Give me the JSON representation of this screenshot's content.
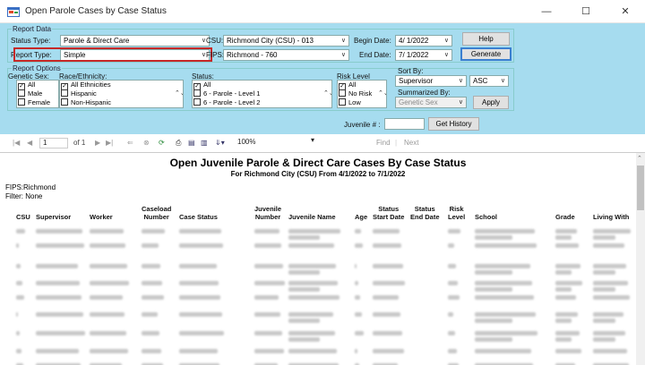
{
  "window": {
    "title": "Open Parole Cases by Case Status",
    "minimize": "—",
    "maximize": "☐",
    "close": "✕"
  },
  "report_data": {
    "legend": "Report Data",
    "status_type_label": "Status Type:",
    "status_type_value": "Parole & Direct Care",
    "report_type_label": "Report Type:",
    "report_type_value": "Simple",
    "csu_label": "CSU:",
    "csu_value": "Richmond City (CSU) - 013",
    "fips_label": "FIPS:",
    "fips_value": "Richmond - 760",
    "begin_label": "Begin Date:",
    "begin_value": "4/ 1/2022",
    "end_label": "End Date:",
    "end_value": "7/ 1/2022",
    "help_button": "Help",
    "generate_button": "Generate"
  },
  "report_options": {
    "legend": "Report Options",
    "genetic_sex_label": "Genetic Sex:",
    "genetic_sex_items": [
      {
        "label": "All",
        "checked": true
      },
      {
        "label": "Male",
        "checked": false
      },
      {
        "label": "Female",
        "checked": false
      }
    ],
    "race_label": "Race/Ethnicity:",
    "race_items": [
      {
        "label": "All Ethnicities",
        "checked": true
      },
      {
        "label": "Hispanic",
        "checked": false
      },
      {
        "label": "Non-Hispanic",
        "checked": false
      }
    ],
    "status_label": "Status:",
    "status_items": [
      {
        "label": "All",
        "checked": true
      },
      {
        "label": "6 - Parole - Level 1",
        "checked": false
      },
      {
        "label": "6 - Parole - Level 2",
        "checked": false
      }
    ],
    "risk_label": "Risk Level",
    "risk_items": [
      {
        "label": "All",
        "checked": true
      },
      {
        "label": "No Risk",
        "checked": false
      },
      {
        "label": "Low",
        "checked": false
      }
    ],
    "sort_label": "Sort By:",
    "sort_value": "Supervisor",
    "sort_dir": "ASC",
    "summarized_label": "Summarized By:",
    "summarized_value": "Genetic Sex",
    "apply_button": "Apply",
    "juvenile_label": "Juvenile # :",
    "juvenile_value": "",
    "history_button": "Get History"
  },
  "toolbar": {
    "first": "|◀",
    "prev": "◀",
    "page": "1",
    "of_pages": "of 1",
    "next": "▶",
    "last": "▶|",
    "zoom": "100%",
    "find": "Find",
    "next_link": "Next"
  },
  "report": {
    "title": "Open Juvenile Parole & Direct Care Cases By Case Status",
    "subtitle": "For Richmond City (CSU) From 4/1/2022 to 7/1/2022",
    "fips": "FIPS:Richmond",
    "filter": "Filter: None",
    "columns": [
      {
        "l1": "",
        "l2": "CSU"
      },
      {
        "l1": "",
        "l2": "Supervisor"
      },
      {
        "l1": "",
        "l2": "Worker"
      },
      {
        "l1": "Caseload",
        "l2": "Number"
      },
      {
        "l1": "",
        "l2": "Case Status"
      },
      {
        "l1": "Juvenile",
        "l2": "Number"
      },
      {
        "l1": "",
        "l2": "Juvenile Name"
      },
      {
        "l1": "",
        "l2": "Age"
      },
      {
        "l1": "Status",
        "l2": "Start Date"
      },
      {
        "l1": "Status",
        "l2": "End Date"
      },
      {
        "l1": "Risk",
        "l2": "Level"
      },
      {
        "l1": "",
        "l2": "School"
      },
      {
        "l1": "",
        "l2": "Grade"
      },
      {
        "l1": "",
        "l2": "Living With"
      }
    ]
  }
}
